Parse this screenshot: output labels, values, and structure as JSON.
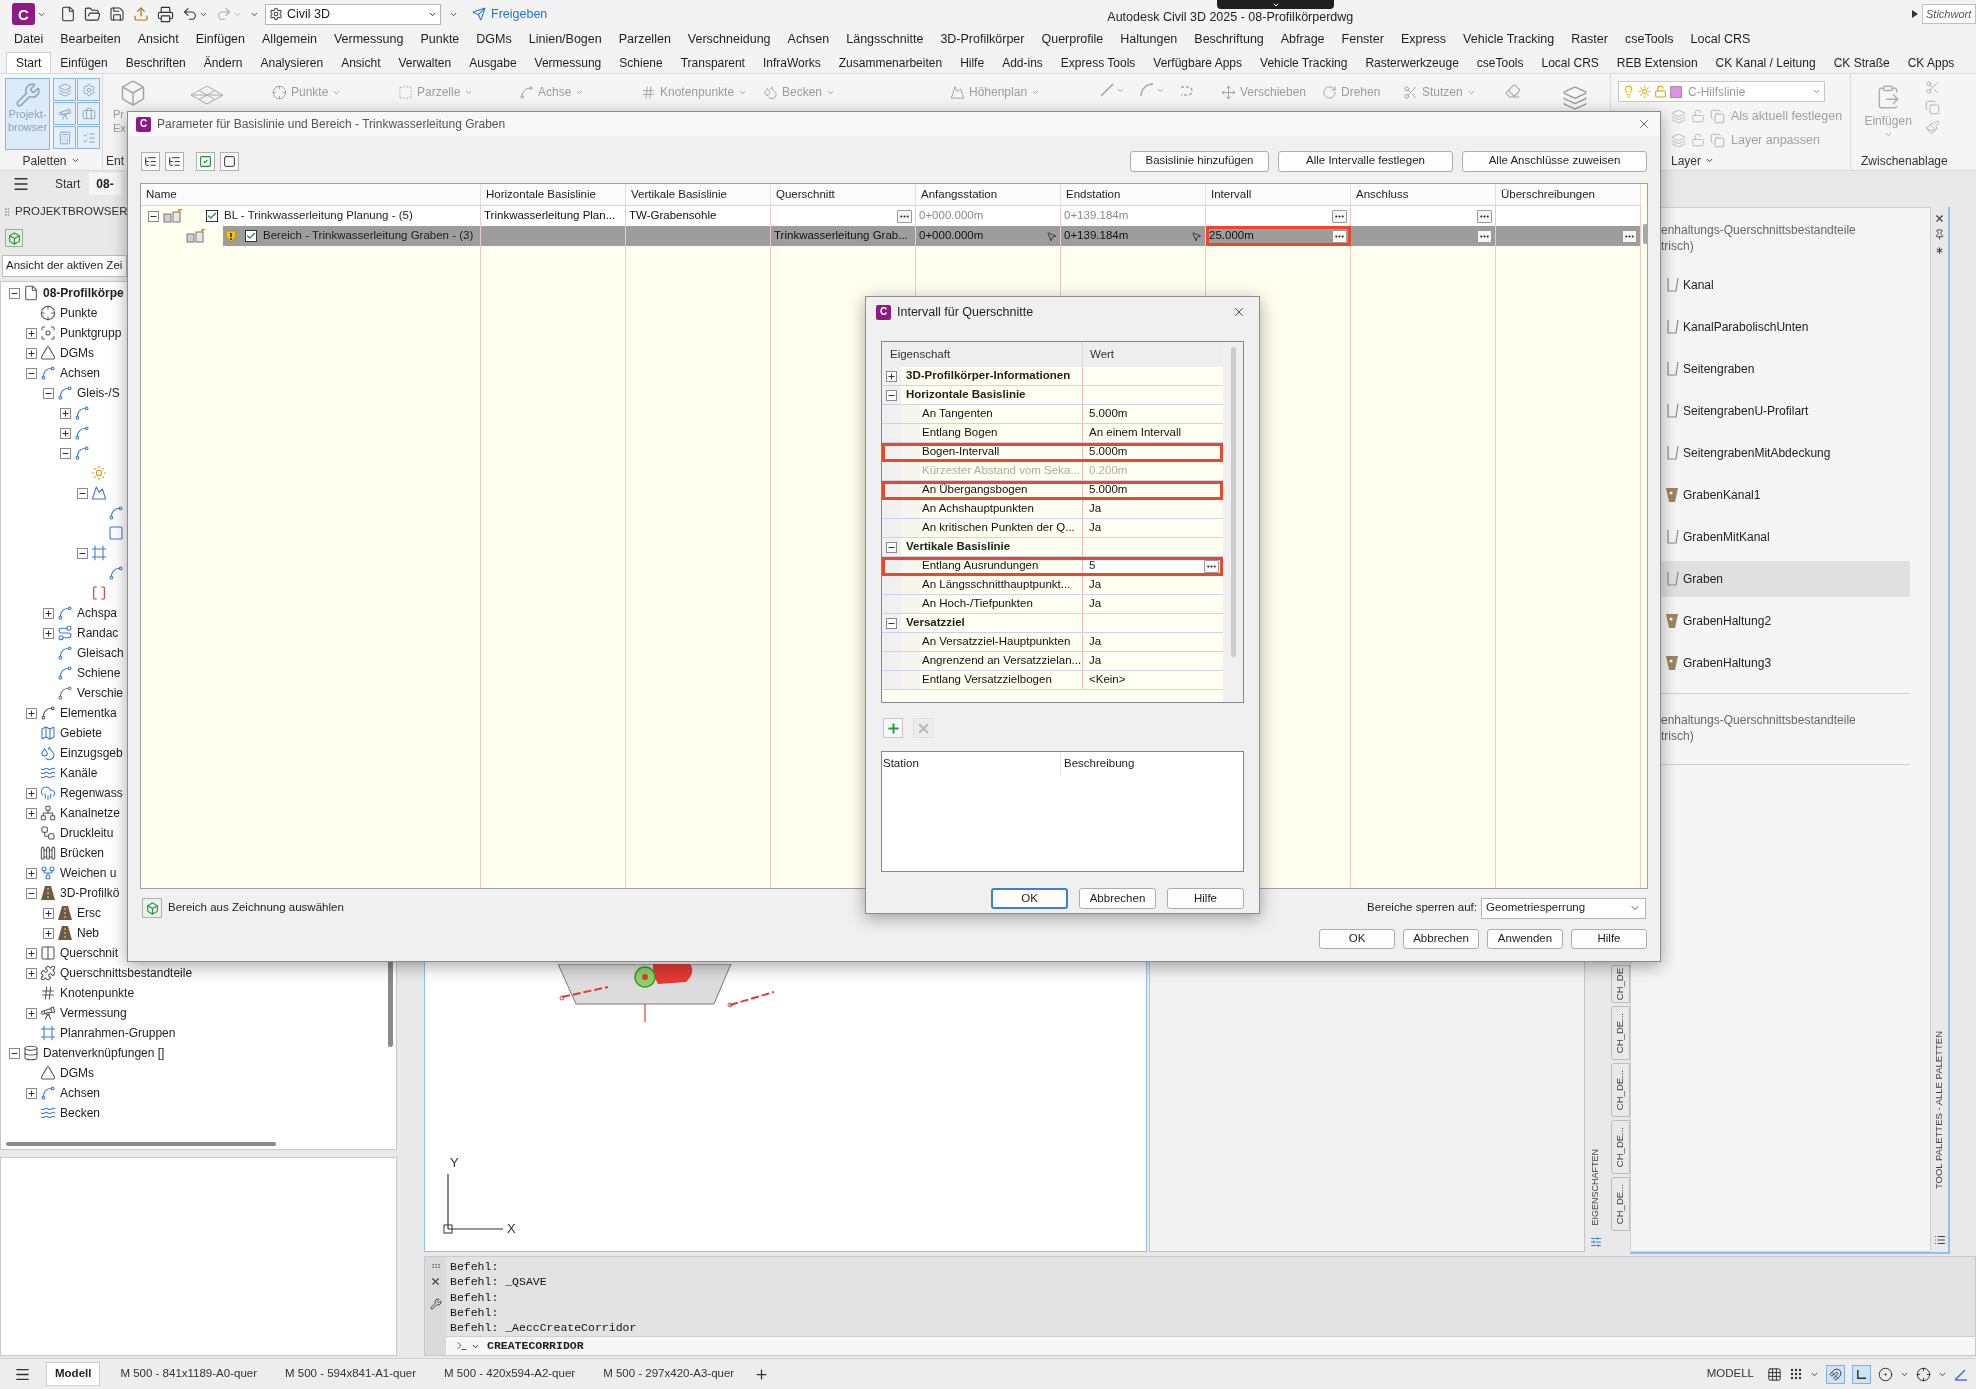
{
  "title_bar": {
    "logo": "C",
    "workspace": "Civil 3D",
    "share": "Freigeben",
    "title": "Autodesk Civil 3D 2025 - 08-Profilkörperdwg",
    "search": {
      "placeholder": "Stichwort"
    }
  },
  "menu": [
    "Datei",
    "Bearbeiten",
    "Ansicht",
    "Einfügen",
    "Allgemein",
    "Vermessung",
    "Punkte",
    "DGMs",
    "Linien/Bogen",
    "Parzellen",
    "Verschneidung",
    "Achsen",
    "Längsschnitte",
    "3D-Profilkörper",
    "Querprofile",
    "Haltungen",
    "Beschriftung",
    "Abfrage",
    "Fenster",
    "Express",
    "Vehicle Tracking",
    "Raster",
    "cseTools",
    "Local CRS"
  ],
  "ribbon_tabs": [
    {
      "label": "Start",
      "selected": true
    },
    {
      "label": "Einfügen",
      "selected": false
    },
    {
      "label": "Beschriften",
      "selected": false
    },
    {
      "label": "Ändern",
      "selected": false
    },
    {
      "label": "Analysieren",
      "selected": false
    },
    {
      "label": "Ansicht",
      "selected": false
    },
    {
      "label": "Verwalten",
      "selected": false
    },
    {
      "label": "Ausgabe",
      "selected": false
    },
    {
      "label": "Vermessung",
      "selected": false
    },
    {
      "label": "Schiene",
      "selected": false
    },
    {
      "label": "Transparent",
      "selected": false
    },
    {
      "label": "InfraWorks",
      "selected": false
    },
    {
      "label": "Zusammenarbeiten",
      "selected": false
    },
    {
      "label": "Hilfe",
      "selected": false
    },
    {
      "label": "Add-ins",
      "selected": false
    },
    {
      "label": "Express Tools",
      "selected": false
    },
    {
      "label": "Verfügbare Apps",
      "selected": false
    },
    {
      "label": "Vehicle Tracking",
      "selected": false
    },
    {
      "label": "Rasterwerkzeuge",
      "selected": false
    },
    {
      "label": "cseTools",
      "selected": false
    },
    {
      "label": "Local CRS",
      "selected": false
    },
    {
      "label": "REB Extension",
      "selected": false
    },
    {
      "label": "CK Kanal / Leitung",
      "selected": false
    },
    {
      "label": "CK Straße",
      "selected": false
    },
    {
      "label": "CK Apps",
      "selected": false
    }
  ],
  "ribbon": {
    "palettes": {
      "button": "Projekt-browser",
      "on": true,
      "toggles": [
        {
          "on": true
        },
        {
          "on": true
        },
        {
          "on": true
        },
        {
          "on": true
        },
        {
          "on": true
        },
        {
          "on": true
        }
      ],
      "label": "Paletten"
    },
    "explorer": {
      "lines": [
        "Pr",
        "Ex"
      ],
      "label": "Ent"
    },
    "tools": [
      {
        "label": "Punkte",
        "dropdown": true
      },
      {
        "label": "Parzelle",
        "dropdown": true
      },
      {
        "label": "Achse",
        "dropdown": true
      },
      {
        "label": "Knotenpunkte",
        "dropdown": true
      },
      {
        "label": "Becken",
        "dropdown": true
      },
      {
        "label": "Höhenplan",
        "dropdown": true
      },
      {
        "label": "Verschieben",
        "dropdown": false
      },
      {
        "label": "Drehen",
        "dropdown": false
      },
      {
        "label": "Stutzen",
        "dropdown": true
      }
    ],
    "layer": {
      "current": "C-Hilfslinie",
      "actions": [
        "Als aktuell festlegen",
        "Layer anpassen"
      ],
      "label": "Layer"
    },
    "clipboard": {
      "button": "Einfügen",
      "label": "Zwischenablage"
    }
  },
  "file_tabs": [
    {
      "label": "Start",
      "selected": false
    },
    {
      "label": "08-",
      "selected": true
    }
  ],
  "browser": {
    "title": "PROJEKTBROWSER",
    "view": "Ansicht der aktiven Zei",
    "tree": [
      {
        "label": "08-Profilkörpe",
        "expanded": true,
        "children": [
          {
            "label": "Punkte"
          },
          {
            "label": "Punktgrupp",
            "expanded": false
          },
          {
            "label": "DGMs",
            "expanded": false
          },
          {
            "label": "Achsen",
            "expanded": true,
            "children": [
              {
                "label": "Gleis-/S",
                "expanded": true,
                "children": [
                  {
                    "kind": "icon_only",
                    "expanded": false
                  },
                  {
                    "kind": "icon_only",
                    "expanded": false
                  },
                  {
                    "kind": "icon_only",
                    "expanded": true,
                    "children": [
                      {
                        "kind": "icon_only"
                      },
                      {
                        "kind": "icon_only",
                        "expanded": true,
                        "children": [
                          {
                            "kind": "icon_only"
                          },
                          {
                            "kind": "icon_only"
                          }
                        ]
                      },
                      {
                        "kind": "icon_only",
                        "expanded": true,
                        "children": [
                          {
                            "kind": "icon_only"
                          }
                        ]
                      },
                      {
                        "kind": "icon_only"
                      }
                    ]
                  }
                ]
              },
              {
                "label": "Achspa",
                "expanded": false
              },
              {
                "label": "Randac",
                "expanded": false
              },
              {
                "label": "Gleisach"
              },
              {
                "label": "Schiene"
              },
              {
                "label": "Verschie"
              }
            ]
          },
          {
            "label": "Elementka",
            "expanded": false
          },
          {
            "label": "Gebiete"
          },
          {
            "label": "Einzugsgeb"
          },
          {
            "label": "Kanäle"
          },
          {
            "label": "Regenwass",
            "expanded": false
          },
          {
            "label": "Kanalnetze",
            "expanded": false
          },
          {
            "label": "Druckleitu"
          },
          {
            "label": "Brücken"
          },
          {
            "label": "Weichen u",
            "expanded": false
          },
          {
            "label": "3D-Profilkö",
            "expanded": true,
            "children": [
              {
                "label": "Ersc",
                "expanded": false
              },
              {
                "label": "Neb",
                "expanded": false
              }
            ]
          },
          {
            "label": "Querschnit",
            "expanded": false
          },
          {
            "label": "Querschnittsbestandteile",
            "expanded": false
          },
          {
            "label": "Knotenpunkte"
          },
          {
            "label": "Vermessung",
            "expanded": false
          },
          {
            "label": "Planrahmen-Gruppen"
          }
        ]
      },
      {
        "label": "Datenverknüpfungen []",
        "expanded": true,
        "children": [
          {
            "label": "DGMs"
          },
          {
            "label": "Achsen",
            "expanded": false
          },
          {
            "label": "Becken"
          }
        ]
      }
    ]
  },
  "drawing": {
    "axis_y": "Y",
    "axis_x": "X"
  },
  "properties": {
    "title": "EIGENSCHAFTEN"
  },
  "tool_palette": {
    "tabs": [
      "CH_DE",
      "CH_DE...",
      "CH_DE...",
      "CH_DE...",
      "CH_DE..."
    ],
    "sections": [
      {
        "title": [
          "enhaltungs-Querschnittsbestandteile",
          "trisch)"
        ],
        "items": [
          {
            "label": "Kanal",
            "selected": false
          },
          {
            "label": "KanalParabolischUnten",
            "selected": false
          },
          {
            "label": "Seitengraben",
            "selected": false
          },
          {
            "label": "SeitengrabenU-Profilart",
            "selected": false
          },
          {
            "label": "SeitengrabenMitAbdeckung",
            "selected": false
          },
          {
            "label": "GrabenKanal1",
            "selected": false
          },
          {
            "label": "GrabenMitKanal",
            "selected": false
          },
          {
            "label": "Graben",
            "selected": true
          },
          {
            "label": "GrabenHaltung2",
            "selected": false
          },
          {
            "label": "GrabenHaltung3",
            "selected": false
          }
        ]
      },
      {
        "title": [
          "enhaltungs-Querschnittsbestandteile",
          "trisch)"
        ]
      }
    ],
    "title": "TOOL PALETTES - ALLE PALETTEN"
  },
  "command_line": {
    "history": [
      "Befehl:",
      "Befehl: _QSAVE",
      "Befehl:",
      "Befehl:",
      "Befehl: _AeccCreateCorridor"
    ],
    "input": "CREATECORRIDOR"
  },
  "status_bar": {
    "layouts": [
      {
        "label": "Modell",
        "selected": true
      },
      {
        "label": "M 500 - 841x1189-A0-quer",
        "selected": false
      },
      {
        "label": "M 500 - 594x841-A1-quer",
        "selected": false
      },
      {
        "label": "M 500 - 420x594-A2-quer",
        "selected": false
      },
      {
        "label": "M 500 - 297x420-A3-quer",
        "selected": false
      }
    ],
    "mode": "MODELL"
  },
  "main_dialog": {
    "logo": "C",
    "title": "Parameter für Basislinie und Bereich - Trinkwasserleitung Graben",
    "actions": [
      "Basislinie hinzufügen",
      "Alle Intervalle festlegen",
      "Alle Anschlüsse zuweisen"
    ],
    "columns": [
      "Name",
      "Horizontale Basislinie",
      "Vertikale Basislinie",
      "Querschnitt",
      "Anfangsstation",
      "Endstation",
      "Intervall",
      "Anschluss",
      "Überschreibungen"
    ],
    "rows": [
      {
        "expanded": true,
        "checked": true,
        "warning": false,
        "selected": false,
        "cells": [
          {
            "kind": "name",
            "text": "BL - Trinkwasserleitung Planung - (5)",
            "highlighted": false
          },
          {
            "kind": "text",
            "text": "Trinkwasserleitung Plan...",
            "highlighted": false
          },
          {
            "kind": "text",
            "text": "TW-Grabensohle",
            "highlighted": false
          },
          {
            "kind": "button",
            "highlighted": false
          },
          {
            "kind": "muted",
            "text": "0+000.000m",
            "highlighted": false
          },
          {
            "kind": "muted",
            "text": "0+139.184m",
            "highlighted": false
          },
          {
            "kind": "button",
            "highlighted": false
          },
          {
            "kind": "button",
            "highlighted": false
          },
          {
            "kind": "empty",
            "highlighted": false
          }
        ],
        "children": [
          {
            "checked": true,
            "warning": true,
            "selected": true,
            "cells": [
              {
                "kind": "name",
                "text": "Bereich - Trinkwasserleitung Graben - (3)",
                "highlighted": false
              },
              {
                "kind": "empty",
                "highlighted": false
              },
              {
                "kind": "empty",
                "highlighted": false
              },
              {
                "kind": "text",
                "text": "Trinkwasserleitung Grab...",
                "highlighted": false
              },
              {
                "kind": "pick",
                "text": "0+000.000m",
                "highlighted": false
              },
              {
                "kind": "pick",
                "text": "0+139.184m",
                "highlighted": false
              },
              {
                "kind": "button",
                "text": "25.000m",
                "highlighted": true
              },
              {
                "kind": "button",
                "highlighted": false
              },
              {
                "kind": "button",
                "highlighted": false
              }
            ]
          }
        ]
      }
    ],
    "pick_range": "Bereich aus Zeichnung auswählen",
    "lock_label": "Bereiche sperren auf:",
    "lock_value": "Geometriesperrung",
    "buttons": [
      "OK",
      "Abbrechen",
      "Anwenden",
      "Hilfe"
    ]
  },
  "interval_dialog": {
    "logo": "C",
    "title": "Intervall für Querschnitte",
    "columns": [
      "Eigenschaft",
      "Wert"
    ],
    "groups": [
      {
        "label": "3D-Profilkörper-Informationen",
        "expanded": false
      },
      {
        "label": "Horizontale Basislinie",
        "expanded": true,
        "children": [
          {
            "label": "An Tangenten",
            "value": "5.000m",
            "kind": "value",
            "disabled": false,
            "highlighted": false
          },
          {
            "label": "Entlang Bogen",
            "value": "An einem Intervall",
            "kind": "value",
            "disabled": false,
            "highlighted": false
          },
          {
            "label": "Bogen-Intervall",
            "value": "5.000m",
            "kind": "value",
            "disabled": false,
            "highlighted": true
          },
          {
            "label": "Kürzester Abstand vom Seka...",
            "value": "0.200m",
            "kind": "value",
            "disabled": true,
            "highlighted": false
          },
          {
            "label": "An Übergangsbogen",
            "value": "5.000m",
            "kind": "value",
            "disabled": false,
            "highlighted": true
          },
          {
            "label": "An Achshauptpunkten",
            "value": "Ja",
            "kind": "value",
            "disabled": false,
            "highlighted": false
          },
          {
            "label": "An kritischen Punkten der Q...",
            "value": "Ja",
            "kind": "value",
            "disabled": false,
            "highlighted": false
          }
        ]
      },
      {
        "label": "Vertikale Basislinie",
        "expanded": true,
        "children": [
          {
            "label": "Entlang Ausrundungen",
            "value": "5",
            "kind": "edit",
            "disabled": false,
            "highlighted": true
          },
          {
            "label": "An Längsschnitthauptpunkt...",
            "value": "Ja",
            "kind": "value",
            "disabled": false,
            "highlighted": false
          },
          {
            "label": "An Hoch-/Tiefpunkten",
            "value": "Ja",
            "kind": "value",
            "disabled": false,
            "highlighted": false
          }
        ]
      },
      {
        "label": "Versatzziel",
        "expanded": true,
        "children": [
          {
            "label": "An Versatzziel-Hauptpunkten",
            "value": "Ja",
            "kind": "value",
            "disabled": false,
            "highlighted": false
          },
          {
            "label": "Angrenzend an Versatzzielan...",
            "value": "Ja",
            "kind": "value",
            "disabled": false,
            "highlighted": false
          },
          {
            "label": "Entlang Versatzzielbogen",
            "value": "<Kein>",
            "kind": "value",
            "disabled": false,
            "highlighted": false
          }
        ]
      }
    ],
    "list_tools": [
      {
        "kind": "add",
        "disabled": false
      },
      {
        "kind": "remove",
        "disabled": true
      }
    ],
    "station_columns": [
      "Station",
      "Beschreibung"
    ],
    "buttons": [
      {
        "label": "OK",
        "default": true
      },
      {
        "label": "Abbrechen",
        "default": false
      },
      {
        "label": "Hilfe",
        "default": false
      }
    ]
  }
}
